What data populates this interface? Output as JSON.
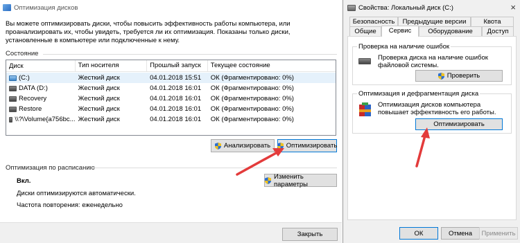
{
  "left": {
    "title": "Оптимизация дисков",
    "description": "Вы можете оптимизировать диски, чтобы повысить эффективность работы  компьютера, или проанализировать их, чтобы увидеть, требуется ли их оптимизация. Показаны только диски, установленные в компьютере или подключенные к нему.",
    "state_label": "Состояние",
    "columns": [
      "Диск",
      "Тип носителя",
      "Прошлый запуск",
      "Текущее состояние"
    ],
    "rows": [
      {
        "disk": "(C:)",
        "type": "Жесткий диск",
        "last": "04.01.2018 15:51",
        "status": "ОК (Фрагментировано: 0%)",
        "icon": "system-drive-icon"
      },
      {
        "disk": "DATA (D:)",
        "type": "Жесткий диск",
        "last": "04.01.2018 16:01",
        "status": "ОК (Фрагментировано: 0%)",
        "icon": "drive-icon"
      },
      {
        "disk": "Recovery",
        "type": "Жесткий диск",
        "last": "04.01.2018 16:01",
        "status": "ОК (Фрагментировано: 0%)",
        "icon": "drive-icon"
      },
      {
        "disk": "Restore",
        "type": "Жесткий диск",
        "last": "04.01.2018 16:01",
        "status": "ОК (Фрагментировано: 0%)",
        "icon": "drive-icon"
      },
      {
        "disk": "\\\\?\\Volume{a756bc...",
        "type": "Жесткий диск",
        "last": "04.01.2018 16:01",
        "status": "ОК (Фрагментировано: 0%)",
        "icon": "drive-icon"
      }
    ],
    "analyze_button": "Анализировать",
    "optimize_button": "Оптимизировать",
    "schedule_title": "Оптимизация по расписанию",
    "schedule_state": "Вкл.",
    "schedule_auto": "Диски оптимизируются автоматически.",
    "schedule_frequency": "Частота повторения: еженедельно",
    "change_settings_button": "Изменить параметры",
    "close_button": "Закрыть"
  },
  "right": {
    "title": "Свойства: Локальный диск (C:)",
    "tabs_row1": [
      "Безопасность",
      "Предыдущие версии",
      "Квота"
    ],
    "tabs_row2": [
      "Общие",
      "Сервис",
      "Оборудование",
      "Доступ"
    ],
    "active_tab": "Сервис",
    "check_group_title": "Проверка на наличие ошибок",
    "check_text": "Проверка диска на наличие ошибок файловой системы.",
    "check_button": "Проверить",
    "defrag_group_title": "Оптимизация и дефрагментация диска",
    "defrag_text": "Оптимизация дисков компьютера повышает эффективность его работы.",
    "optimize_button": "Оптимизировать",
    "ok_button": "ОК",
    "cancel_button": "Отмена",
    "apply_button": "Применить"
  },
  "colors": {
    "accent": "#0078d7",
    "arrow": "#e33b3b",
    "selected_row": "#e5f1fb"
  }
}
